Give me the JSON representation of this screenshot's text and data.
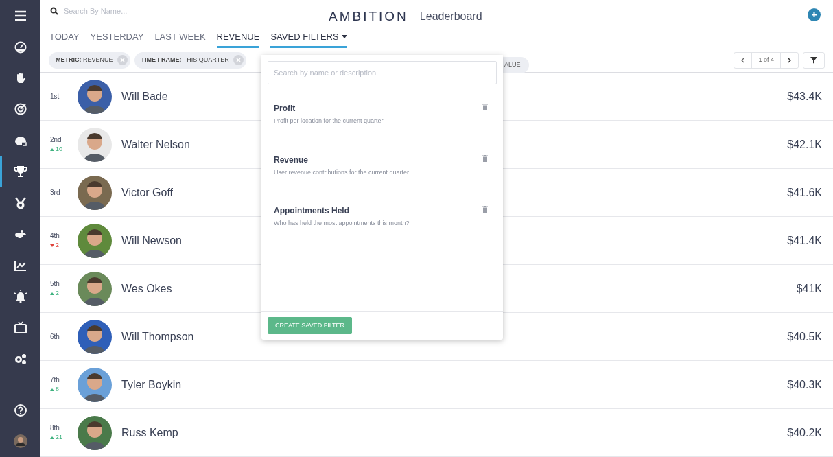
{
  "sidebar": {
    "items": [
      {
        "selected": false
      },
      {
        "selected": false
      },
      {
        "selected": false
      },
      {
        "selected": false
      },
      {
        "selected": false
      },
      {
        "selected": true
      },
      {
        "selected": false
      },
      {
        "selected": false
      },
      {
        "selected": false
      },
      {
        "selected": false
      },
      {
        "selected": false
      },
      {
        "selected": false
      }
    ]
  },
  "search": {
    "placeholder": "Search By Name..."
  },
  "logo": {
    "brand": "AMBITION",
    "page": "Leaderboard"
  },
  "tabs": [
    {
      "kind": "plain",
      "label": "TODAY",
      "selected": false
    },
    {
      "kind": "plain",
      "label": "YESTERDAY",
      "selected": false
    },
    {
      "kind": "plain",
      "label": "LAST WEEK",
      "selected": false
    },
    {
      "kind": "plain",
      "label": "REVENUE",
      "selected": true
    },
    {
      "kind": "dropdown",
      "label": "SAVED FILTERS",
      "selected": true
    }
  ],
  "chips": [
    {
      "key": "METRIC:",
      "value": "REVENUE"
    },
    {
      "key": "TIME FRAME:",
      "value": "THIS QUARTER"
    }
  ],
  "hidden_chip": {
    "text": "ALUE"
  },
  "pager": {
    "text": "1 of 4"
  },
  "rows": [
    {
      "rank": "1st",
      "name": "Will Bade",
      "value": "$43.4K"
    },
    {
      "rank": "2nd",
      "change": {
        "kind": "up",
        "value": "10"
      },
      "name": "Walter Nelson",
      "value": "$42.1K"
    },
    {
      "rank": "3rd",
      "name": "Victor Goff",
      "value": "$41.6K"
    },
    {
      "rank": "4th",
      "change": {
        "kind": "down",
        "value": "2"
      },
      "name": "Will Newson",
      "value": "$41.4K"
    },
    {
      "rank": "5th",
      "change": {
        "kind": "up",
        "value": "2"
      },
      "name": "Wes Okes",
      "value": "$41K"
    },
    {
      "rank": "6th",
      "name": "Will Thompson",
      "value": "$40.5K"
    },
    {
      "rank": "7th",
      "change": {
        "kind": "up",
        "value": "8"
      },
      "name": "Tyler Boykin",
      "value": "$40.3K"
    },
    {
      "rank": "8th",
      "change": {
        "kind": "up",
        "value": "21"
      },
      "name": "Russ Kemp",
      "value": "$40.2K"
    }
  ],
  "dropdown": {
    "search": {
      "placeholder": "Search by name or description"
    },
    "filters": [
      {
        "title": "Profit",
        "description": "Profit per location for the current quarter"
      },
      {
        "title": "Revenue",
        "description": "User revenue contributions for the current quarter."
      },
      {
        "title": "Appointments Held",
        "description": "Who has held the most appointments this month?"
      }
    ],
    "button": "CREATE SAVED FILTER"
  }
}
